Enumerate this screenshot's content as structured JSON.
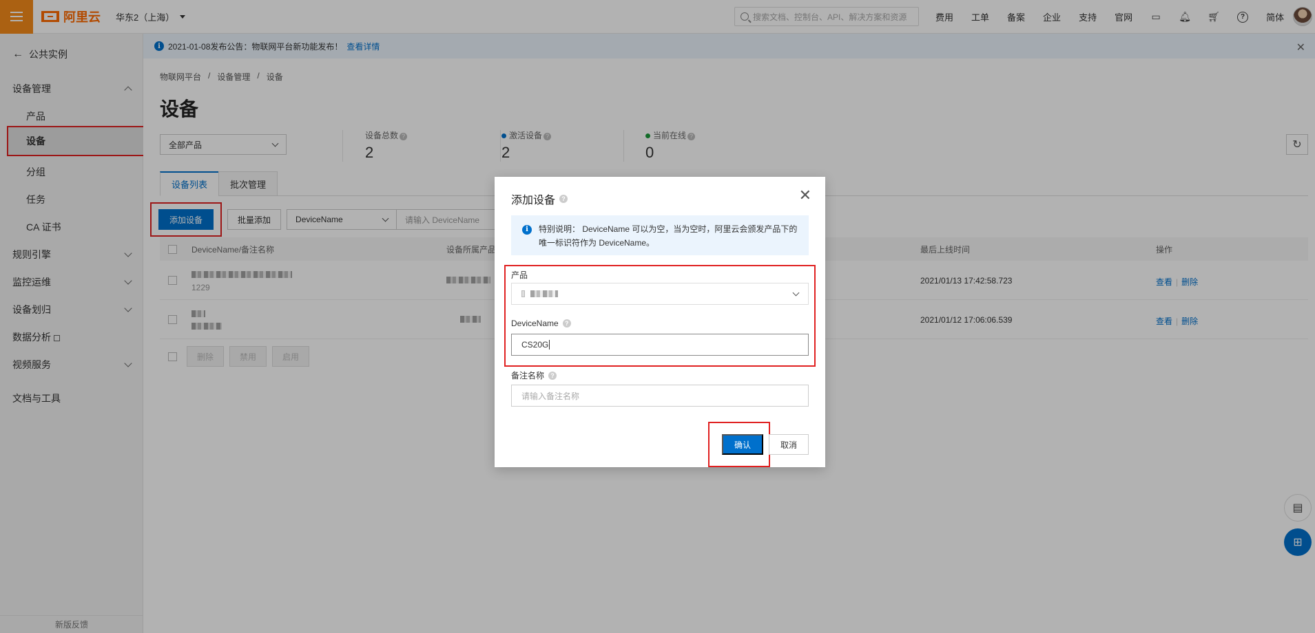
{
  "topbar": {
    "brand": "阿里云",
    "region": "华东2（上海）",
    "search_placeholder": "搜索文档、控制台、API、解决方案和资源",
    "links": [
      "费用",
      "工单",
      "备案",
      "企业",
      "支持",
      "官网"
    ],
    "lang": "简体"
  },
  "sidebar": {
    "back_label": "公共实例",
    "groups": {
      "device_mgmt": "设备管理",
      "rule_engine": "规则引擎",
      "monitor": "监控运维",
      "assign": "设备划归",
      "analysis": "数据分析",
      "video": "视频服务",
      "docs": "文档与工具"
    },
    "items": {
      "product": "产品",
      "device": "设备",
      "group": "分组",
      "task": "任务",
      "ca": "CA 证书"
    },
    "footer": "新版反馈"
  },
  "notice": {
    "text": "2021-01-08发布公告：物联网平台新功能发布！",
    "link": "查看详情"
  },
  "breadcrumb": [
    "物联网平台",
    "设备管理",
    "设备"
  ],
  "page": {
    "title": "设备",
    "product_filter": "全部产品",
    "stats": {
      "total_label": "设备总数",
      "total_value": "2",
      "active_label": "激活设备",
      "active_value": "2",
      "online_label": "当前在线",
      "online_value": "0"
    },
    "tabs": [
      "设备列表",
      "批次管理"
    ],
    "toolbar": {
      "add_label": "添加设备",
      "batch_label": "批量添加",
      "filter_field": "DeviceName",
      "filter_placeholder": "请输入 DeviceName"
    },
    "table": {
      "headers": {
        "name": "DeviceName/备注名称",
        "product": "设备所属产品",
        "last_online": "最后上线时间",
        "action": "操作"
      },
      "rows": [
        {
          "sub": "1229",
          "last_online": "2021/01/13 17:42:58.723"
        },
        {
          "sub": "",
          "last_online": "2021/01/12 17:06:06.539"
        }
      ],
      "action_view": "查看",
      "action_delete": "删除",
      "bulk": [
        "删除",
        "禁用",
        "启用"
      ]
    }
  },
  "modal": {
    "title": "添加设备",
    "info": "特别说明： DeviceName 可以为空，当为空时，阿里云会颁发产品下的唯一标识符作为 DeviceName。",
    "product_label": "产品",
    "devicename_label": "DeviceName",
    "devicename_value": "CS20G",
    "remark_label": "备注名称",
    "remark_placeholder": "请输入备注名称",
    "confirm": "确认",
    "cancel": "取消"
  },
  "colors": {
    "brand": "#ff6a00",
    "primary": "#0070cc",
    "highlight": "#e02020"
  }
}
